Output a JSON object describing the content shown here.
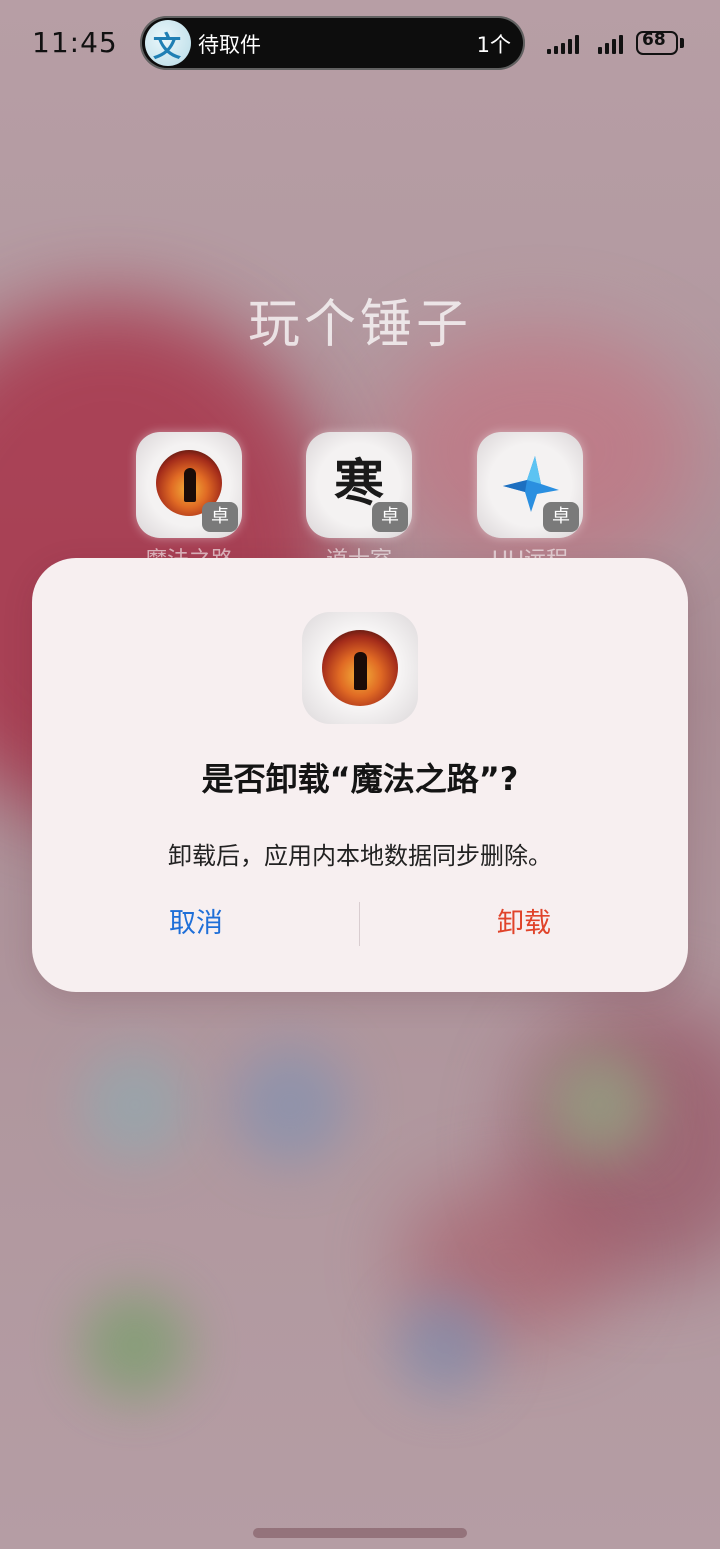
{
  "status_bar": {
    "time": "11:45",
    "pill_icon_glyph": "文",
    "pill_text": "待取件",
    "pill_count": "1个",
    "battery": "68"
  },
  "folder": {
    "title": "玩个锤子",
    "apps": [
      {
        "label": "魔法之路",
        "badge": "卓",
        "icon": "mage-silhouette-icon"
      },
      {
        "label": "道士室",
        "badge": "卓",
        "icon": "ink-calligraphy-icon",
        "glyph": "寒"
      },
      {
        "label": "UU远程",
        "badge": "卓",
        "icon": "uu-remote-icon"
      }
    ]
  },
  "dialog": {
    "title": "是否卸载“魔法之路”?",
    "message": "卸载后，应用内本地数据同步删除。",
    "cancel_label": "取消",
    "confirm_label": "卸载",
    "cancel_color": "#1f6fd8",
    "confirm_color": "#e0432a"
  }
}
